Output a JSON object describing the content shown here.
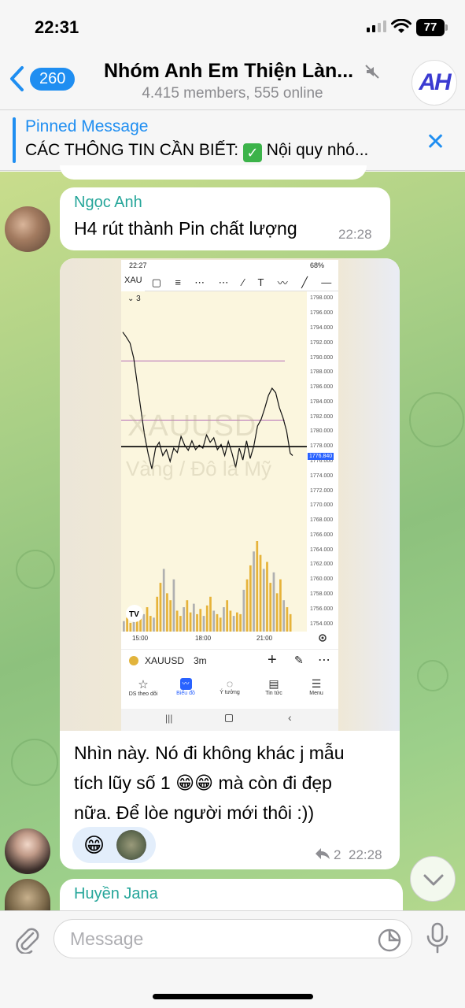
{
  "status_bar": {
    "time": "22:31",
    "battery": "77"
  },
  "header": {
    "back_count": "260",
    "title": "Nhóm Anh Em Thiện Làn...",
    "subtitle": "4.415 members, 555 online",
    "avatar_text": "AH"
  },
  "pinned": {
    "title": "Pinned Message",
    "text_before": "CÁC THÔNG TIN CẦN BIẾT:",
    "text_after": "Nội quy nhó...",
    "check": "✓"
  },
  "messages": [
    {
      "sender": "Ngọc Anh",
      "text": "H4 rút thành Pin chất lượng",
      "time": "22:28"
    },
    {
      "text_line1": "Nhìn này. Nó đi không khác j mẫu",
      "text_line2": "tích lũy số 1 😁😁 mà còn đi đẹp",
      "text_line3": "nữa. Để lòe người mới thôi :))",
      "reaction": "😁",
      "reply_count": "2",
      "time": "22:28"
    },
    {
      "sender": "Huyền Jana"
    }
  ],
  "chart_screenshot": {
    "status_time": "22:27",
    "status_battery": "68%",
    "symbol_short": "XAU",
    "interval_chip": "3",
    "watermark_1": "XAUUSD",
    "watermark_2": "Vàng / Đô la Mỹ",
    "symbol": "XAUUSD",
    "interval": "3m",
    "price_label": "1776.840",
    "x_ticks": [
      "15:00",
      "18:00",
      "21:00"
    ],
    "y_ticks": [
      "1798.000",
      "1796.000",
      "1794.000",
      "1792.000",
      "1790.000",
      "1788.000",
      "1786.000",
      "1784.000",
      "1782.000",
      "1780.000",
      "1778.000",
      "1776.000",
      "1774.000",
      "1772.000",
      "1770.000",
      "1768.000",
      "1766.000",
      "1764.000",
      "1762.000",
      "1760.000",
      "1758.000",
      "1756.000",
      "1754.000"
    ],
    "nav": [
      "DS theo dõi",
      "Biểu đồ",
      "Ý tưởng",
      "Tin tức",
      "Menu"
    ]
  },
  "chart_data": {
    "type": "line",
    "ylim": [
      1753,
      1799
    ],
    "x": [
      0,
      3,
      6,
      9,
      12,
      15,
      18,
      21,
      24,
      27,
      30,
      33,
      36,
      39,
      42,
      45,
      48,
      51,
      54,
      57,
      60,
      63,
      66,
      69,
      72,
      75,
      78,
      81,
      84,
      87,
      90,
      93,
      96,
      99,
      102,
      105,
      108,
      111,
      114,
      117,
      120,
      123,
      126,
      129,
      132,
      135,
      138,
      140
    ],
    "values": [
      1793.5,
      1792.8,
      1792,
      1790,
      1786.5,
      1783,
      1779.5,
      1777,
      1775,
      1777.8,
      1778.6,
      1776.8,
      1777.6,
      1776,
      1777.8,
      1777.2,
      1779.4,
      1778.2,
      1777.5,
      1778.8,
      1777.6,
      1778.2,
      1777.8,
      1779.6,
      1778.6,
      1779.2,
      1777.6,
      1778.3,
      1776.8,
      1778.7,
      1777.1,
      1775.2,
      1777.8,
      1776.2,
      1778.8,
      1776.4,
      1778.1,
      1780.8,
      1781.7,
      1783.2,
      1784.9,
      1785.9,
      1785.3,
      1783.3,
      1781.9,
      1780.1,
      1777.1,
      1776.8
    ],
    "hlines": [
      {
        "value": 1789.6,
        "color": "#9c3fa8"
      },
      {
        "value": 1781.6,
        "color": "#9c3fa8"
      },
      {
        "value": 1778.0,
        "color": "#000000"
      }
    ],
    "volume": [
      6,
      8,
      5,
      9,
      7,
      12,
      10,
      14,
      9,
      8,
      20,
      28,
      36,
      22,
      18,
      30,
      12,
      9,
      14,
      18,
      11,
      16,
      10,
      13,
      9,
      15,
      20,
      12,
      10,
      8,
      14,
      18,
      12,
      9,
      11,
      10,
      24,
      30,
      38,
      46,
      52,
      44,
      36,
      40,
      28,
      34,
      22,
      30,
      18,
      14,
      10
    ]
  },
  "composer": {
    "placeholder": "Message"
  },
  "colors": {
    "accent": "#1f8ef1",
    "sender": "#26a69a",
    "chart_bg": "#fbf6de",
    "volume_up": "#e6b33a",
    "volume_down": "#b0b0b0"
  }
}
